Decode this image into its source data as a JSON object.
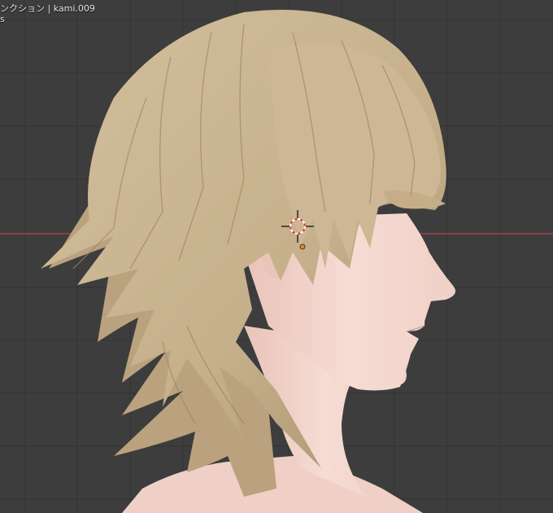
{
  "viewport": {
    "collection_text": "ンクション | kami.009",
    "mode_text": "s",
    "background_color": "#3d3d3d",
    "grid_color": "#333333",
    "x_axis_color": "#c2484f",
    "hair_color": "#c9b491",
    "skin_color": "#f2d3cb",
    "cursor_icon": "3d-cursor-icon",
    "origin_icon": "object-origin-icon"
  }
}
